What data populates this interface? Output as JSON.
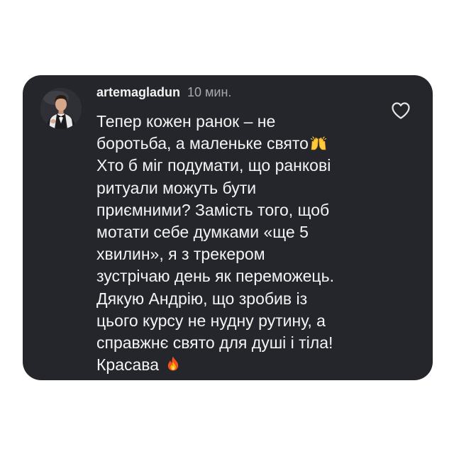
{
  "comment": {
    "username": "artemagladun",
    "timestamp": "10 мин.",
    "lines": [
      "Тепер кожен ранок – не",
      "боротьба, а маленьке свято",
      "Хто б міг подумати, що ранкові",
      "ритуали можуть бути",
      "приємними? Замість того, щоб",
      "мотати себе думками «ще 5",
      "хвилин», я з трекером",
      "зустрічаю день як переможець.",
      "Дякую Андрію, що зробив із",
      "цього курсу не нудну рутину, а",
      "справжнє свято для душі і тіла!",
      "Красава"
    ],
    "emojis": {
      "line_2": "raising-hands-emoji",
      "line_12": "fire-emoji"
    },
    "like_icon": "heart-icon"
  },
  "colors": {
    "card_background": "#25262b",
    "text_primary": "#f4f4f4",
    "text_secondary": "#a9a9ad"
  }
}
